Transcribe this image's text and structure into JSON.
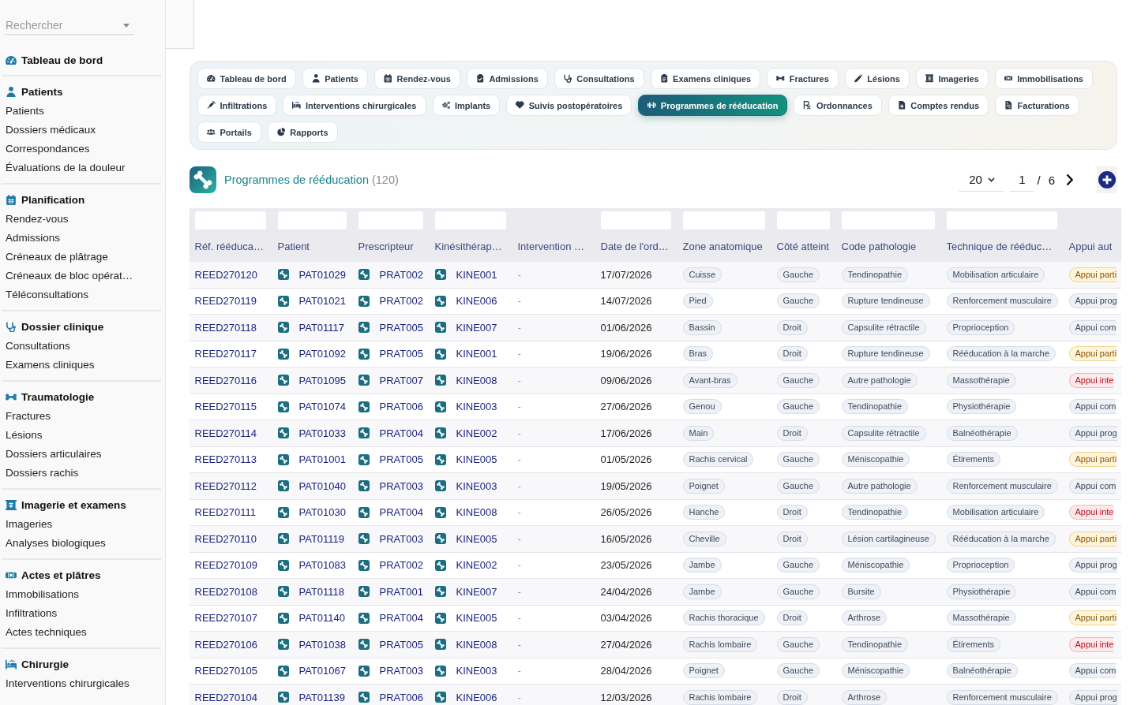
{
  "sidebar": {
    "search": {
      "placeholder": "Rechercher"
    },
    "sections": [
      {
        "title": "Tableau de bord"
      },
      {
        "title": "Patients",
        "items": [
          "Patients",
          "Dossiers médicaux",
          "Correspondances",
          "Évaluations de la douleur"
        ]
      },
      {
        "title": "Planification",
        "items": [
          "Rendez-vous",
          "Admissions",
          "Créneaux de plâtrage",
          "Créneaux de bloc opérat…",
          "Téléconsultations"
        ]
      },
      {
        "title": "Dossier clinique",
        "items": [
          "Consultations",
          "Examens cliniques"
        ]
      },
      {
        "title": "Traumatologie",
        "items": [
          "Fractures",
          "Lésions",
          "Dossiers articulaires",
          "Dossiers rachis"
        ]
      },
      {
        "title": "Imagerie et examens",
        "items": [
          "Imageries",
          "Analyses biologiques"
        ]
      },
      {
        "title": "Actes et plâtres",
        "items": [
          "Immobilisations",
          "Infiltrations",
          "Actes techniques"
        ]
      },
      {
        "title": "Chirurgie",
        "items": [
          "Interventions chirurgicales"
        ]
      }
    ]
  },
  "tabs": [
    {
      "label": "Tableau de bord",
      "selected": false
    },
    {
      "label": "Patients",
      "selected": false
    },
    {
      "label": "Rendez-vous",
      "selected": false
    },
    {
      "label": "Admissions",
      "selected": false
    },
    {
      "label": "Consultations",
      "selected": false
    },
    {
      "label": "Examens cliniques",
      "selected": false
    },
    {
      "label": "Fractures",
      "selected": false
    },
    {
      "label": "Lésions",
      "selected": false
    },
    {
      "label": "Imageries",
      "selected": false
    },
    {
      "label": "Immobilisations",
      "selected": false
    },
    {
      "label": "Infiltrations",
      "selected": false
    },
    {
      "label": "Interventions chirurgicales",
      "selected": false
    },
    {
      "label": "Implants",
      "selected": false
    },
    {
      "label": "Suivis postopératoires",
      "selected": false
    },
    {
      "label": "Programmes de rééducation",
      "selected": true
    },
    {
      "label": "Ordonnances",
      "selected": false
    },
    {
      "label": "Comptes rendus",
      "selected": false
    },
    {
      "label": "Facturations",
      "selected": false
    },
    {
      "label": "Portails",
      "selected": false
    },
    {
      "label": "Rapports",
      "selected": false
    }
  ],
  "header": {
    "title": "Programmes de rééducation",
    "count": "(120)"
  },
  "pagination": {
    "page_size": "20",
    "page": "1",
    "separator": "/",
    "total_pages": "6"
  },
  "table": {
    "columns": [
      {
        "label": "Réf. rééduca…",
        "filter": true,
        "kind": "link"
      },
      {
        "label": "Patient",
        "filter": true,
        "kind": "entity"
      },
      {
        "label": "Prescripteur",
        "filter": true,
        "kind": "entity"
      },
      {
        "label": "Kinésithérap…",
        "filter": true,
        "kind": "entity"
      },
      {
        "label": "Intervention …",
        "filter": false,
        "kind": "empty"
      },
      {
        "label": "Date de l'ord…",
        "filter": true,
        "kind": "date"
      },
      {
        "label": "Zone anatomique",
        "filter": true,
        "kind": "tag"
      },
      {
        "label": "Côté atteint",
        "filter": true,
        "kind": "tag"
      },
      {
        "label": "Code pathologie",
        "filter": true,
        "kind": "tag"
      },
      {
        "label": "Technique de rééduc…",
        "filter": true,
        "kind": "tag"
      },
      {
        "label": "Appui aut",
        "filter": false,
        "kind": "status"
      }
    ],
    "rows": [
      {
        "cells": [
          "REED270120",
          "PAT01029",
          "PRAT002",
          "KINE001",
          "-",
          "17/07/2026",
          "Cuisse",
          "Gauche",
          "Tendinopathie",
          "Mobilisation articulaire"
        ],
        "support": {
          "text": "Appui parti",
          "kind": "warning"
        }
      },
      {
        "cells": [
          "REED270119",
          "PAT01021",
          "PRAT002",
          "KINE006",
          "-",
          "14/07/2026",
          "Pied",
          "Gauche",
          "Rupture tendineuse",
          "Renforcement musculaire"
        ],
        "support": {
          "text": "Appui prog",
          "kind": "neutral"
        }
      },
      {
        "cells": [
          "REED270118",
          "PAT01117",
          "PRAT005",
          "KINE007",
          "-",
          "01/06/2026",
          "Bassin",
          "Droit",
          "Capsulite rétractile",
          "Proprioception"
        ],
        "support": {
          "text": "Appui com",
          "kind": "neutral"
        }
      },
      {
        "cells": [
          "REED270117",
          "PAT01092",
          "PRAT005",
          "KINE001",
          "-",
          "19/06/2026",
          "Bras",
          "Droit",
          "Rupture tendineuse",
          "Rééducation à la marche"
        ],
        "support": {
          "text": "Appui parti",
          "kind": "warning"
        }
      },
      {
        "cells": [
          "REED270116",
          "PAT01095",
          "PRAT007",
          "KINE008",
          "-",
          "09/06/2026",
          "Avant-bras",
          "Gauche",
          "Autre pathologie",
          "Massothérapie"
        ],
        "support": {
          "text": "Appui inte",
          "kind": "danger"
        }
      },
      {
        "cells": [
          "REED270115",
          "PAT01074",
          "PRAT006",
          "KINE003",
          "-",
          "27/06/2026",
          "Genou",
          "Gauche",
          "Tendinopathie",
          "Physiothérapie"
        ],
        "support": {
          "text": "Appui com",
          "kind": "neutral"
        }
      },
      {
        "cells": [
          "REED270114",
          "PAT01033",
          "PRAT004",
          "KINE002",
          "-",
          "17/06/2026",
          "Main",
          "Droit",
          "Capsulite rétractile",
          "Balnéothérapie"
        ],
        "support": {
          "text": "Appui prog",
          "kind": "neutral"
        }
      },
      {
        "cells": [
          "REED270113",
          "PAT01001",
          "PRAT005",
          "KINE005",
          "-",
          "01/05/2026",
          "Rachis cervical",
          "Gauche",
          "Méniscopathie",
          "Étirements"
        ],
        "support": {
          "text": "Appui parti",
          "kind": "warning"
        }
      },
      {
        "cells": [
          "REED270112",
          "PAT01040",
          "PRAT003",
          "KINE003",
          "-",
          "19/05/2026",
          "Poignet",
          "Gauche",
          "Autre pathologie",
          "Renforcement musculaire"
        ],
        "support": {
          "text": "Appui com",
          "kind": "neutral"
        }
      },
      {
        "cells": [
          "REED270111",
          "PAT01030",
          "PRAT004",
          "KINE008",
          "-",
          "26/05/2026",
          "Hanche",
          "Droit",
          "Tendinopathie",
          "Mobilisation articulaire"
        ],
        "support": {
          "text": "Appui inte",
          "kind": "danger"
        }
      },
      {
        "cells": [
          "REED270110",
          "PAT01119",
          "PRAT003",
          "KINE005",
          "-",
          "16/05/2026",
          "Cheville",
          "Droit",
          "Lésion cartilagineuse",
          "Rééducation à la marche"
        ],
        "support": {
          "text": "Appui parti",
          "kind": "warning"
        }
      },
      {
        "cells": [
          "REED270109",
          "PAT01083",
          "PRAT002",
          "KINE002",
          "-",
          "23/05/2026",
          "Jambe",
          "Gauche",
          "Méniscopathie",
          "Proprioception"
        ],
        "support": {
          "text": "Appui prog",
          "kind": "neutral"
        }
      },
      {
        "cells": [
          "REED270108",
          "PAT01118",
          "PRAT001",
          "KINE007",
          "-",
          "24/04/2026",
          "Jambe",
          "Gauche",
          "Bursite",
          "Physiothérapie"
        ],
        "support": {
          "text": "Appui com",
          "kind": "neutral"
        }
      },
      {
        "cells": [
          "REED270107",
          "PAT01140",
          "PRAT004",
          "KINE005",
          "-",
          "03/04/2026",
          "Rachis thoracique",
          "Droit",
          "Arthrose",
          "Massothérapie"
        ],
        "support": {
          "text": "Appui parti",
          "kind": "warning"
        }
      },
      {
        "cells": [
          "REED270106",
          "PAT01038",
          "PRAT005",
          "KINE008",
          "-",
          "27/04/2026",
          "Rachis lombaire",
          "Gauche",
          "Tendinopathie",
          "Étirements"
        ],
        "support": {
          "text": "Appui inte",
          "kind": "danger"
        }
      },
      {
        "cells": [
          "REED270105",
          "PAT01067",
          "PRAT003",
          "KINE003",
          "-",
          "28/04/2026",
          "Poignet",
          "Gauche",
          "Méniscopathie",
          "Balnéothérapie"
        ],
        "support": {
          "text": "Appui com",
          "kind": "neutral"
        }
      },
      {
        "cells": [
          "REED270104",
          "PAT01139",
          "PRAT006",
          "KINE006",
          "-",
          "12/03/2026",
          "Rachis lombaire",
          "Droit",
          "Arthrose",
          "Renforcement musculaire"
        ],
        "support": {
          "text": "Appui prog",
          "kind": "neutral"
        }
      }
    ]
  }
}
